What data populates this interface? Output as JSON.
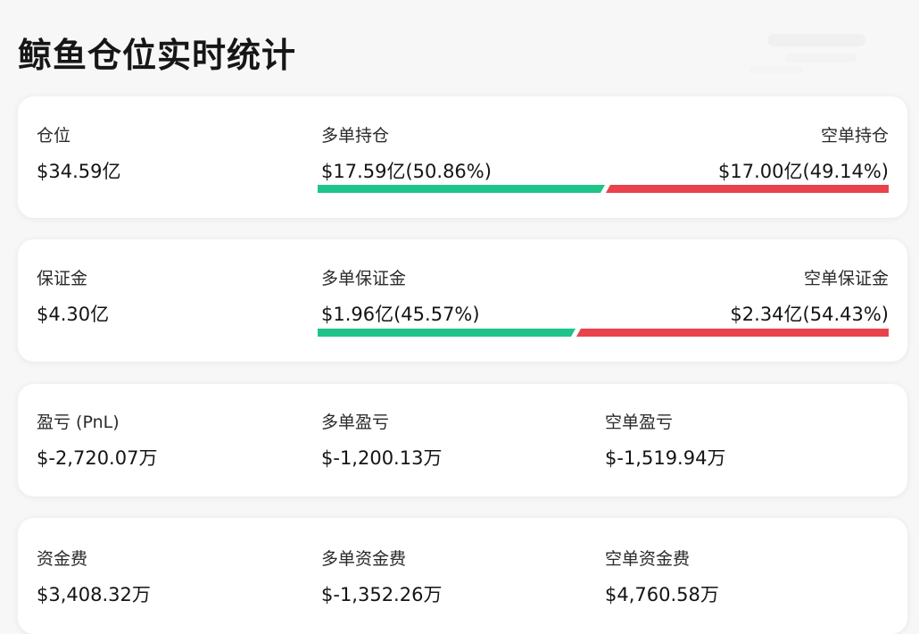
{
  "page": {
    "title": "鲸鱼仓位实时统计"
  },
  "colors": {
    "long": "#1fc48a",
    "short": "#e9424c",
    "card": "#ffffff",
    "background": "#f7f7f8"
  },
  "position": {
    "label": "仓位",
    "value": "$34.59亿",
    "long_label": "多单持仓",
    "long_value": "$17.59亿(50.86%)",
    "long_ratio": 0.5086,
    "short_label": "空单持仓",
    "short_value": "$17.00亿(49.14%)",
    "short_ratio": 0.4914
  },
  "margin": {
    "label": "保证金",
    "value": "$4.30亿",
    "long_label": "多单保证金",
    "long_value": "$1.96亿(45.57%)",
    "long_ratio": 0.4557,
    "short_label": "空单保证金",
    "short_value": "$2.34亿(54.43%)",
    "short_ratio": 0.5443
  },
  "pnl": {
    "label": "盈亏 (PnL)",
    "value": "$-2,720.07万",
    "long_label": "多单盈亏",
    "long_value": "$-1,200.13万",
    "short_label": "空单盈亏",
    "short_value": "$-1,519.94万"
  },
  "funding": {
    "label": "资金费",
    "value": "$3,408.32万",
    "long_label": "多单资金费",
    "long_value": "$-1,352.26万",
    "short_label": "空单资金费",
    "short_value": "$4,760.58万"
  }
}
